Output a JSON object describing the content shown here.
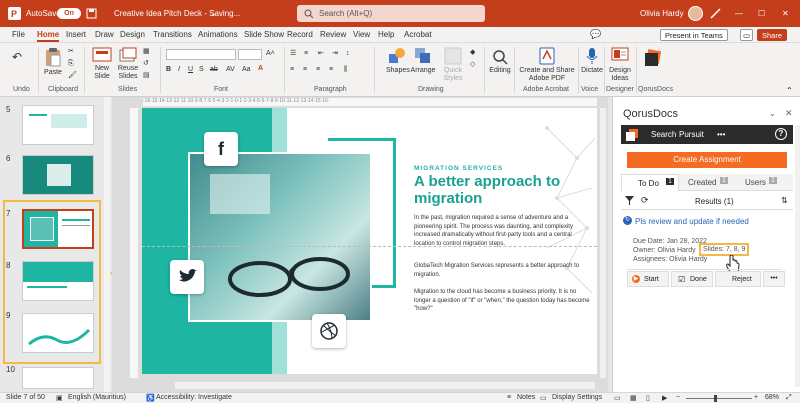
{
  "titlebar": {
    "autosave_label": "AutoSave",
    "autosave_state": "On",
    "doc_title": "Creative Idea Pitch Deck - Saving...",
    "search_placeholder": "Search (Alt+Q)",
    "user_name": "Olivia Hardy"
  },
  "menu": {
    "tabs": [
      "File",
      "Home",
      "Insert",
      "Draw",
      "Design",
      "Transitions",
      "Animations",
      "Slide Show",
      "Record",
      "Review",
      "View",
      "Help",
      "Acrobat"
    ],
    "active": "Home",
    "present_label": "Present in Teams",
    "share_label": "Share"
  },
  "ribbon": {
    "groups": [
      "Undo",
      "Clipboard",
      "Slides",
      "Font",
      "Paragraph",
      "Drawing",
      "Adobe Acrobat",
      "Voice",
      "Designer",
      "QorusDocs"
    ],
    "paste_label": "Paste",
    "new_slide_label": "New Slide",
    "reuse_slides_label": "Reuse Slides",
    "shapes_label": "Shapes",
    "arrange_label": "Arrange",
    "quick_styles_label": "Quick Styles",
    "editing_label": "Editing",
    "create_share_label": "Create and Share Adobe PDF",
    "dictate_label": "Dictate",
    "design_ideas_label": "Design Ideas"
  },
  "thumbs": [
    "5",
    "6",
    "7",
    "8",
    "9",
    "10"
  ],
  "slide": {
    "eyebrow": "MIGRATION SERVICES",
    "heading": "A better approach to migration",
    "p1": "In the past, migration required a sense of adventure and a pioneering spirit. The process was daunting, and complexity increased dramatically without first-party tools and a central location to control migration steps.",
    "p2": "GlobaTech Migration Services represents a better approach to migration.",
    "p3": "Migration to the cloud has become a business priority. It is no longer a question of \"if\" or \"when,\" the question today has become \"how?\""
  },
  "pane": {
    "title": "QorusDocs",
    "nav_search": "Search",
    "nav_pursuit": "Pursuit",
    "nav_more": "•••",
    "help": "?",
    "create_label": "Create Assignment",
    "tabs": [
      {
        "label": "To Do",
        "count": "1"
      },
      {
        "label": "Created",
        "count": "1"
      },
      {
        "label": "Users",
        "count": "1"
      }
    ],
    "results": "Results (1)",
    "task": "Pls review and update if needed",
    "due": "Due Date:  Jan 28, 2022",
    "owner": "Owner:  Olivia Hardy",
    "slides": "Slides: 7, 8, 9",
    "assignees": "Assignees:  Olivia Hardy",
    "actions": [
      "Start",
      "Done",
      "Reject",
      "•••"
    ]
  },
  "status": {
    "slide": "Slide 7 of 50",
    "language": "English (Mauritius)",
    "accessibility": "Accessibility: Investigate",
    "notes": "Notes",
    "display": "Display Settings",
    "zoom": "68%"
  },
  "colors": {
    "accent": "#c43e1c",
    "teal": "#1fb5a3",
    "pane_header": "#2b2b2b",
    "orange": "#f36c21"
  }
}
